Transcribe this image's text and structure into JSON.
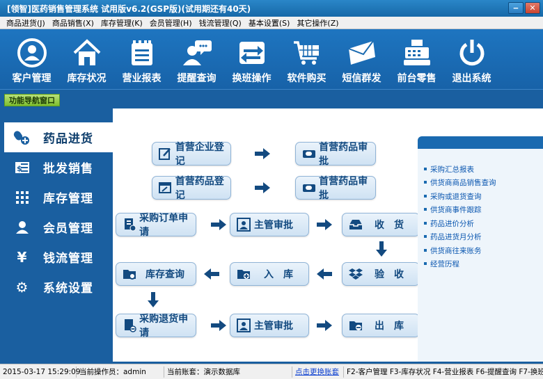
{
  "window": {
    "title": "[领智]医药销售管理系统 试用版v6.2(GSP版)(试用期还有40天)"
  },
  "menu": [
    "商品进货(J)",
    "商品销售(X)",
    "库存管理(K)",
    "会员管理(H)",
    "钱流管理(Q)",
    "基本设置(S)",
    "其它操作(Z)"
  ],
  "toolbar": [
    {
      "label": "客户管理",
      "icon": "user-circle-icon"
    },
    {
      "label": "库存状况",
      "icon": "home-icon"
    },
    {
      "label": "营业报表",
      "icon": "notepad-icon"
    },
    {
      "label": "提醒查询",
      "icon": "chat-user-icon"
    },
    {
      "label": "换班操作",
      "icon": "swap-icon"
    },
    {
      "label": "软件购买",
      "icon": "cart-icon"
    },
    {
      "label": "短信群发",
      "icon": "envelope-icon"
    },
    {
      "label": "前台零售",
      "icon": "cash-register-icon"
    },
    {
      "label": "退出系统",
      "icon": "power-icon"
    }
  ],
  "nav_tab": "功能导航窗口",
  "sidebar": [
    {
      "label": "药品进货",
      "icon": "pills-icon",
      "active": true
    },
    {
      "label": "批发销售",
      "icon": "ledger-icon",
      "active": false
    },
    {
      "label": "库存管理",
      "icon": "grid-icon",
      "active": false
    },
    {
      "label": "会员管理",
      "icon": "person-icon",
      "active": false
    },
    {
      "label": "钱流管理",
      "icon": "yen-icon",
      "active": false
    },
    {
      "label": "系统设置",
      "icon": "gear-icon",
      "active": false
    }
  ],
  "flow": {
    "supplier_register": "首营企业登记",
    "drug_approve_1": "首营药品审批",
    "drug_register": "首营药品登记",
    "drug_approve_2": "首营药品审批",
    "purchase_order": "采购订单申请",
    "supervisor_approve_1": "主管审批",
    "receive": "收　货",
    "inventory_query": "库存查询",
    "stock_in": "入　库",
    "inspect": "验　收",
    "return_request": "采购退货申请",
    "supervisor_approve_2": "主管审批",
    "stock_out": "出　库"
  },
  "right_panel": {
    "links": [
      "采购汇总报表",
      "供货商商品销售查询",
      "采购或退货查询",
      "供货商事件跟踪",
      "药品进价分析",
      "药品进货月分析",
      "供货商往来账务",
      "经营历程"
    ]
  },
  "status": {
    "datetime": "2015-03-17 15:29:09",
    "operator": "当前操作员：admin",
    "account": "当前账套：演示数据库",
    "switch_link": "点击更换账套",
    "shortcuts": "F2-客户管理 F3-库存状况 F4-营业报表 F6-提醒查询 F7-换班"
  },
  "colors": {
    "accent": "#1a5fa0",
    "nav_green": "#7fbf2f",
    "link": "#0b57b0"
  }
}
